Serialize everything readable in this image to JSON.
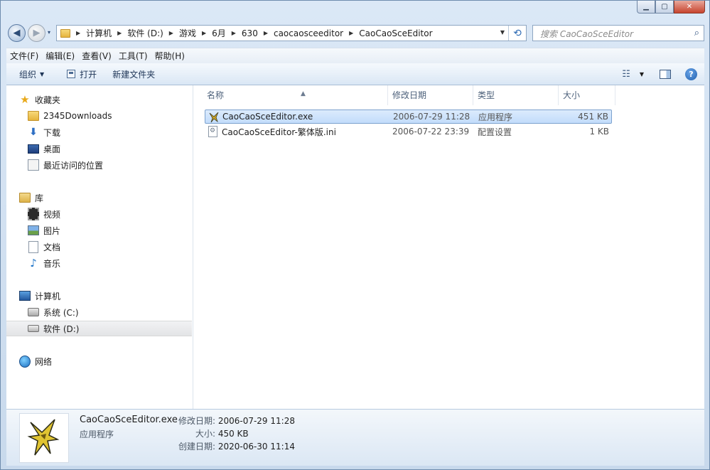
{
  "window": {
    "minimize_glyph": "▁",
    "maximize_glyph": "▢",
    "close_glyph": "✕"
  },
  "navigation": {
    "back_glyph": "◀",
    "forward_glyph": "▶",
    "recent_glyph": "▾",
    "breadcrumbs": [
      "计算机",
      "软件 (D:)",
      "游戏",
      "6月",
      "630",
      "caocaosceeditor",
      "CaoCaoSceEditor"
    ],
    "refresh_glyph": "⟲"
  },
  "search": {
    "placeholder": "搜索 CaoCaoSceEditor",
    "icon_glyph": "⌕"
  },
  "menubar": [
    "文件(F)",
    "编辑(E)",
    "查看(V)",
    "工具(T)",
    "帮助(H)"
  ],
  "toolbar": {
    "organize_label": "组织",
    "open_label": "打开",
    "new_folder_label": "新建文件夹",
    "help_glyph": "?"
  },
  "sidebar": {
    "favorites": {
      "label": "收藏夹",
      "items": [
        "2345Downloads",
        "下载",
        "桌面",
        "最近访问的位置"
      ]
    },
    "libraries": {
      "label": "库",
      "items": [
        "视频",
        "图片",
        "文档",
        "音乐"
      ]
    },
    "computer": {
      "label": "计算机",
      "items": [
        "系统 (C:)",
        "软件 (D:)"
      ]
    },
    "network": {
      "label": "网络"
    }
  },
  "columns": [
    "名称",
    "修改日期",
    "类型",
    "大小"
  ],
  "files": [
    {
      "name": "CaoCaoSceEditor.exe",
      "modified": "2006-07-29 11:28",
      "type": "应用程序",
      "size": "451 KB",
      "icon": "exe-icon"
    },
    {
      "name": "CaoCaoSceEditor-繁体版.ini",
      "modified": "2006-07-22 23:39",
      "type": "配置设置",
      "size": "1 KB",
      "icon": "ini-icon"
    }
  ],
  "details": {
    "name": "CaoCaoSceEditor.exe",
    "type": "应用程序",
    "modified_label": "修改日期:",
    "modified_value": "2006-07-29 11:28",
    "size_label": "大小:",
    "size_value": "450 KB",
    "created_label": "创建日期:",
    "created_value": "2020-06-30 11:14"
  }
}
